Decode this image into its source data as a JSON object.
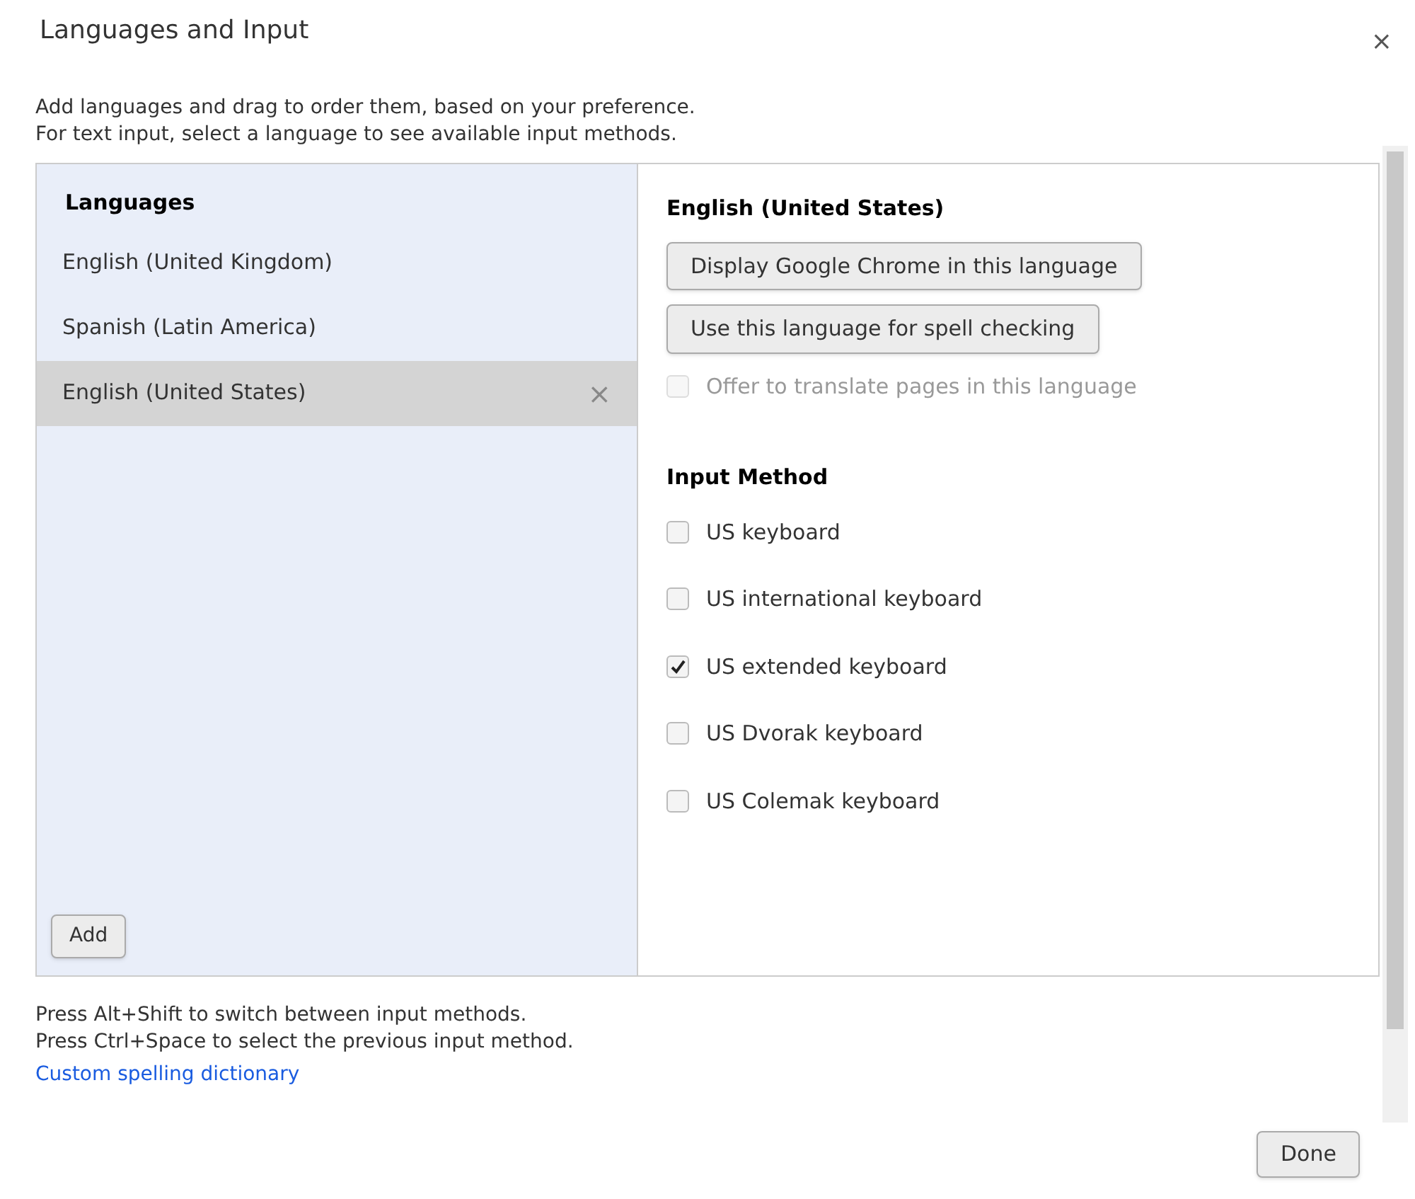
{
  "dialog": {
    "title": "Languages and Input",
    "close": "×"
  },
  "description": [
    "Add languages and drag to order them, based on your preference.",
    "For text input, select a language to see available input methods."
  ],
  "languages": {
    "heading": "Languages",
    "items": [
      {
        "label": "English (United Kingdom)",
        "selected": false
      },
      {
        "label": "Spanish (Latin America)",
        "selected": false
      },
      {
        "label": "English (United States)",
        "selected": true,
        "remove": "×"
      }
    ],
    "add_button": "Add"
  },
  "details": {
    "heading": "English (United States)",
    "buttons": [
      "Display Google Chrome in this language",
      "Use this language for spell checking"
    ],
    "translate_option": {
      "label": "Offer to translate pages in this language",
      "checked": false,
      "disabled": true
    },
    "input_method_heading": "Input Method",
    "input_methods": [
      {
        "label": "US keyboard",
        "checked": false
      },
      {
        "label": "US international keyboard",
        "checked": false
      },
      {
        "label": "US extended keyboard",
        "checked": true
      },
      {
        "label": "US Dvorak keyboard",
        "checked": false
      },
      {
        "label": "US Colemak keyboard",
        "checked": false
      }
    ]
  },
  "footer": {
    "notes": [
      "Press Alt+Shift to switch between input methods.",
      "Press Ctrl+Space to select the previous input method."
    ],
    "link": "Custom spelling dictionary"
  },
  "done_button": "Done"
}
